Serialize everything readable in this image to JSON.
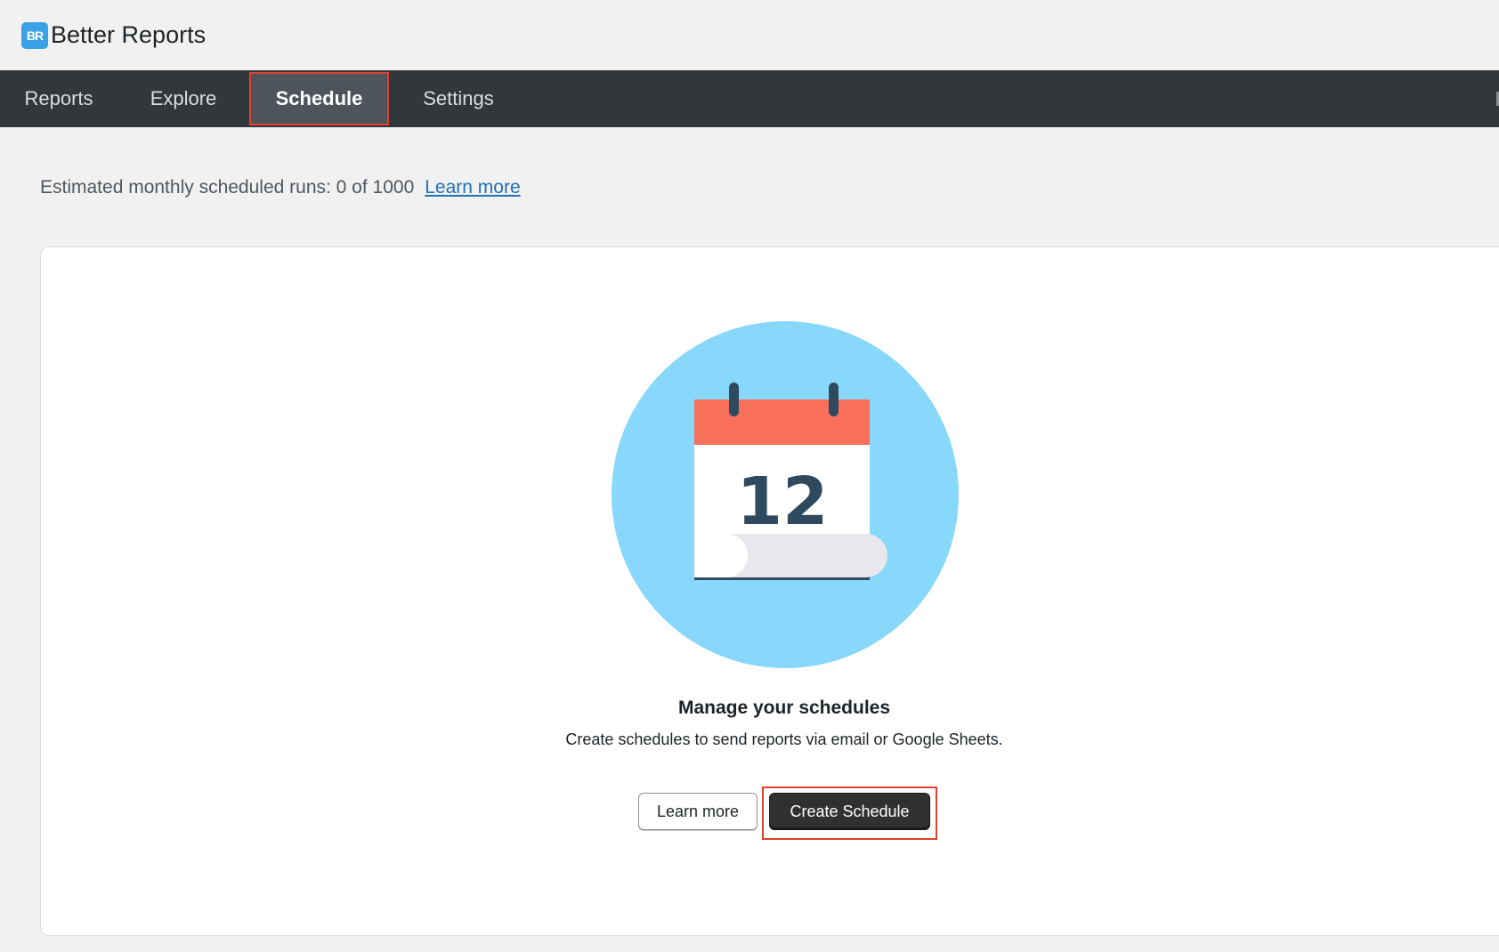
{
  "app": {
    "logo_text": "BR",
    "title": "Better Reports"
  },
  "nav": {
    "tabs": [
      {
        "label": "Reports"
      },
      {
        "label": "Explore"
      },
      {
        "label": "Schedule",
        "active": true
      },
      {
        "label": "Settings"
      }
    ]
  },
  "usage": {
    "text": "Estimated monthly scheduled runs: 0 of 1000",
    "link": "Learn more"
  },
  "empty_state": {
    "illustration": "calendar-icon",
    "calendar_day": "12",
    "title": "Manage your schedules",
    "description": "Create schedules to send reports via email or Google Sheets.",
    "learn_more_label": "Learn more",
    "create_label": "Create Schedule"
  },
  "colors": {
    "nav_bg": "#32373c",
    "active_tab_bg": "#4d545b",
    "highlight_outline": "#e0412c",
    "link": "#2271b1",
    "illustration_circle": "#87d8fb",
    "calendar_header": "#f9705a",
    "calendar_dark": "#2f4a5f",
    "primary_button": "#303030"
  }
}
